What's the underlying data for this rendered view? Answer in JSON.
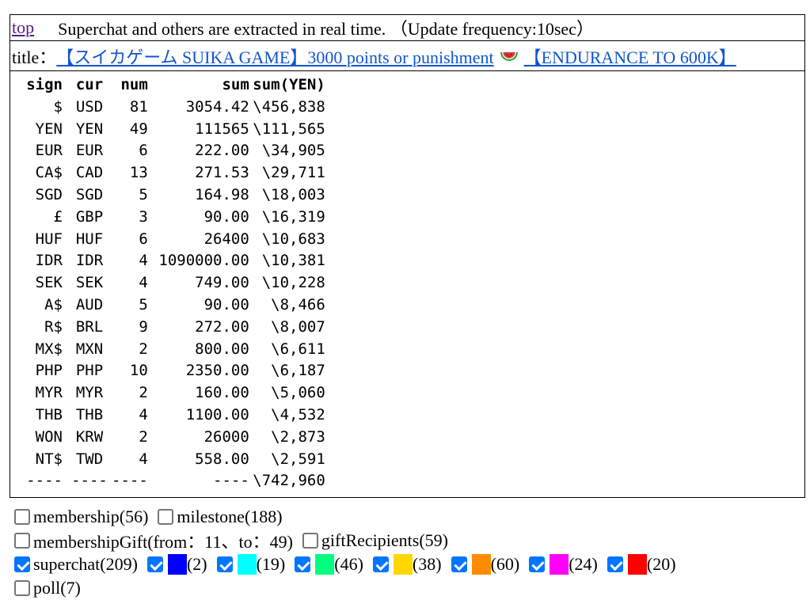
{
  "nav": {
    "top_link": "top",
    "notice": "Superchat and others are extracted in real time. （Update frequency:10sec）"
  },
  "title": {
    "prefix": "title：",
    "part1": "【スイカゲーム SUIKA GAME】3000 points or punishment",
    "part2": "【ENDURANCE TO 600K】",
    "icon": "watermelon-icon"
  },
  "table": {
    "headers": [
      "sign",
      "cur",
      "num",
      "sum",
      "sum(YEN)"
    ],
    "rows": [
      [
        "$",
        "USD",
        "81",
        "3054.42",
        "\\456,838"
      ],
      [
        "YEN",
        "YEN",
        "49",
        "111565",
        "\\111,565"
      ],
      [
        "EUR",
        "EUR",
        "6",
        "222.00",
        "\\34,905"
      ],
      [
        "CA$",
        "CAD",
        "13",
        "271.53",
        "\\29,711"
      ],
      [
        "SGD",
        "SGD",
        "5",
        "164.98",
        "\\18,003"
      ],
      [
        "£",
        "GBP",
        "3",
        "90.00",
        "\\16,319"
      ],
      [
        "HUF",
        "HUF",
        "6",
        "26400",
        "\\10,683"
      ],
      [
        "IDR",
        "IDR",
        "4",
        "1090000.00",
        "\\10,381"
      ],
      [
        "SEK",
        "SEK",
        "4",
        "749.00",
        "\\10,228"
      ],
      [
        "A$",
        "AUD",
        "5",
        "90.00",
        "\\8,466"
      ],
      [
        "R$",
        "BRL",
        "9",
        "272.00",
        "\\8,007"
      ],
      [
        "MX$",
        "MXN",
        "2",
        "800.00",
        "\\6,611"
      ],
      [
        "PHP",
        "PHP",
        "10",
        "2350.00",
        "\\6,187"
      ],
      [
        "MYR",
        "MYR",
        "2",
        "160.00",
        "\\5,060"
      ],
      [
        "THB",
        "THB",
        "4",
        "1100.00",
        "\\4,532"
      ],
      [
        "WON",
        "KRW",
        "2",
        "26000",
        "\\2,873"
      ],
      [
        "NT$",
        "TWD",
        "4",
        "558.00",
        "\\2,591"
      ]
    ],
    "total": [
      "----",
      "----",
      "----",
      "----",
      "\\742,960"
    ]
  },
  "filters": {
    "row1": [
      {
        "label": "membership(56)",
        "checked": false
      },
      {
        "label": "milestone(188)",
        "checked": false
      }
    ],
    "row2": [
      {
        "label": "membershipGift(from：11、to：49)",
        "checked": false
      },
      {
        "label": "giftRecipients(59)",
        "checked": false
      }
    ],
    "superchat": {
      "label": "superchat(209)",
      "checked": true
    },
    "tiers": [
      {
        "color": "#0000ff",
        "count": "(2)",
        "checked": true
      },
      {
        "color": "#00ffff",
        "count": "(19)",
        "checked": true
      },
      {
        "color": "#00ff7f",
        "count": "(46)",
        "checked": true
      },
      {
        "color": "#ffd700",
        "count": "(38)",
        "checked": true
      },
      {
        "color": "#ff8c00",
        "count": "(60)",
        "checked": true
      },
      {
        "color": "#ff00ff",
        "count": "(24)",
        "checked": true
      },
      {
        "color": "#ff0000",
        "count": "(20)",
        "checked": true
      }
    ],
    "row4": {
      "label": "poll(7)",
      "checked": false
    }
  }
}
